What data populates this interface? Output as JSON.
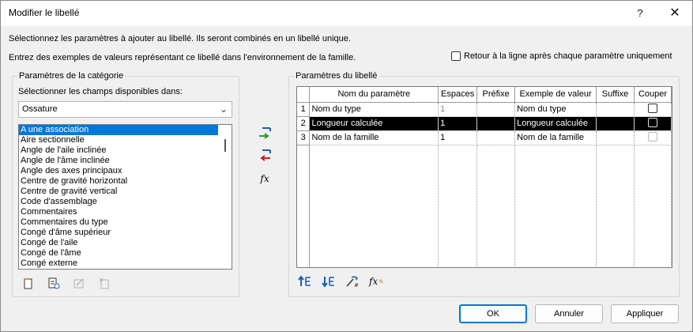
{
  "dialog": {
    "title": "Modifier le libellé",
    "help": "?",
    "close": "✕"
  },
  "instructions": {
    "line1": "Sélectionnez les paramètres à ajouter au libellé. Ils seront combinés en un libellé unique.",
    "line2": "Entrez des exemples de valeurs représentant ce libellé dans l'environnement de la famille.",
    "wrap_label": "Retour à la ligne après chaque paramètre uniquement"
  },
  "category": {
    "group_label": "Paramètres de la catégorie",
    "select_label": "Sélectionner les champs disponibles dans:",
    "selected_source": "Ossature",
    "items": [
      "A une association",
      "Aire sectionnelle",
      "Angle de l'aile inclinée",
      "Angle de l'âme inclinée",
      "Angle des axes principaux",
      "Centre de gravité horizontal",
      "Centre de gravité vertical",
      "Code d'assemblage",
      "Commentaires",
      "Commentaires du type",
      "Congé d'âme supérieur",
      "Congé de l'aile",
      "Congé de l'âme",
      "Congé externe"
    ]
  },
  "label_params": {
    "group_label": "Paramètres du libellé",
    "columns": [
      "",
      "Nom du paramètre",
      "Espaces",
      "Préfixe",
      "Exemple de valeur",
      "Suffixe",
      "Couper"
    ],
    "rows": [
      {
        "num": "1",
        "name": "Nom du type",
        "spaces": "1",
        "prefix": "",
        "example": "Nom du type",
        "suffix": ""
      },
      {
        "num": "2",
        "name": "Longueur calculée",
        "spaces": "1",
        "prefix": "",
        "example": "Longueur calculée",
        "suffix": ""
      },
      {
        "num": "3",
        "name": "Nom de la famille",
        "spaces": "1",
        "prefix": "",
        "example": "Nom de la famille",
        "suffix": ""
      }
    ]
  },
  "buttons": {
    "ok": "OK",
    "cancel": "Annuler",
    "apply": "Appliquer"
  },
  "icons": {
    "add_param": "add-parameter-icon",
    "remove_param": "remove-parameter-icon",
    "fx": "fx-icon",
    "new_param": "new-parameter-icon",
    "edit_param": "edit-parameter-icon",
    "edit_disabled": "edit-disabled-icon",
    "delete_param": "delete-parameter-icon",
    "move_up": "move-up-icon",
    "move_down": "move-down-icon",
    "format": "format-icon",
    "fx_edit": "fx-edit-icon"
  },
  "colors": {
    "accent": "#0078d7",
    "selection_row": "#000000"
  }
}
